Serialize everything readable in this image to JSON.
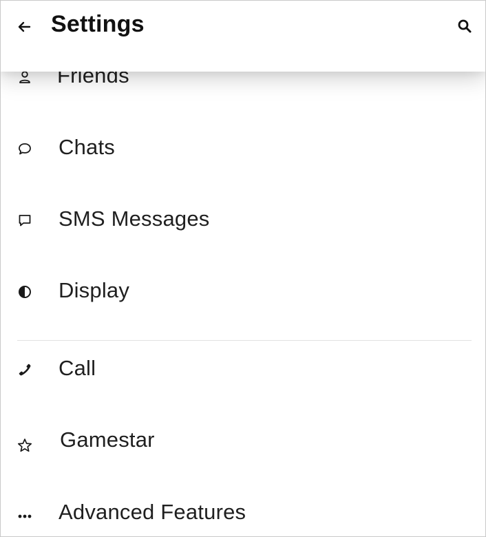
{
  "header": {
    "title": "Settings",
    "back_icon": "arrow-left-icon",
    "search_icon": "search-icon"
  },
  "settings": {
    "items": [
      {
        "label": "Friends",
        "icon": "person-icon"
      },
      {
        "label": "Chats",
        "icon": "chat-bubble-icon"
      },
      {
        "label": "SMS Messages",
        "icon": "message-square-icon"
      },
      {
        "label": "Display",
        "icon": "contrast-icon"
      },
      {
        "label": "Call",
        "icon": "phone-icon"
      },
      {
        "label": "Gamestar",
        "icon": "star-icon"
      },
      {
        "label": "Advanced Features",
        "icon": "more-horizontal-icon"
      }
    ]
  }
}
